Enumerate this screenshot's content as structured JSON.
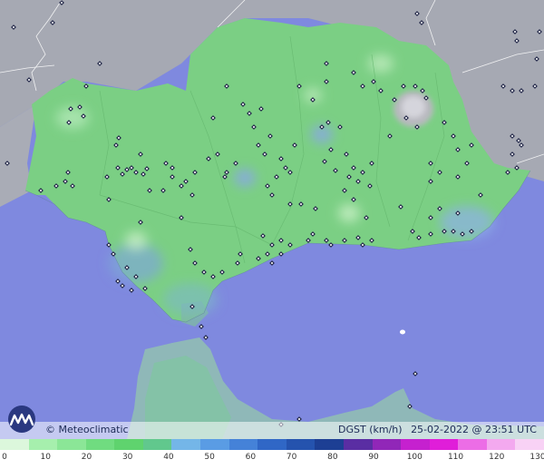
{
  "brand": {
    "label": "© Meteoclimatic"
  },
  "info": {
    "variable": "DGST (km/h)",
    "datetime": "25-02-2022 @ 23:51 UTC"
  },
  "legend": {
    "ticks": [
      "0",
      "10",
      "20",
      "30",
      "40",
      "50",
      "60",
      "70",
      "80",
      "90",
      "100",
      "110",
      "120",
      "130"
    ],
    "colors": [
      "#dcf7dc",
      "#a6efad",
      "#8be697",
      "#70dc80",
      "#5fd36e",
      "#61c88d",
      "#74b6e8",
      "#5a9ce4",
      "#4582d8",
      "#3067c6",
      "#2553ae",
      "#1d3f94",
      "#5a2ea3",
      "#9127b8",
      "#c521cf",
      "#e01ed9",
      "#ec6de6",
      "#f3a9ef",
      "#f8d2f5"
    ]
  },
  "colors": {
    "sea": "#7f89df",
    "land": "#7bcf84",
    "neighbor_land": "#a6a9b3",
    "borders": "#ffffff"
  }
}
